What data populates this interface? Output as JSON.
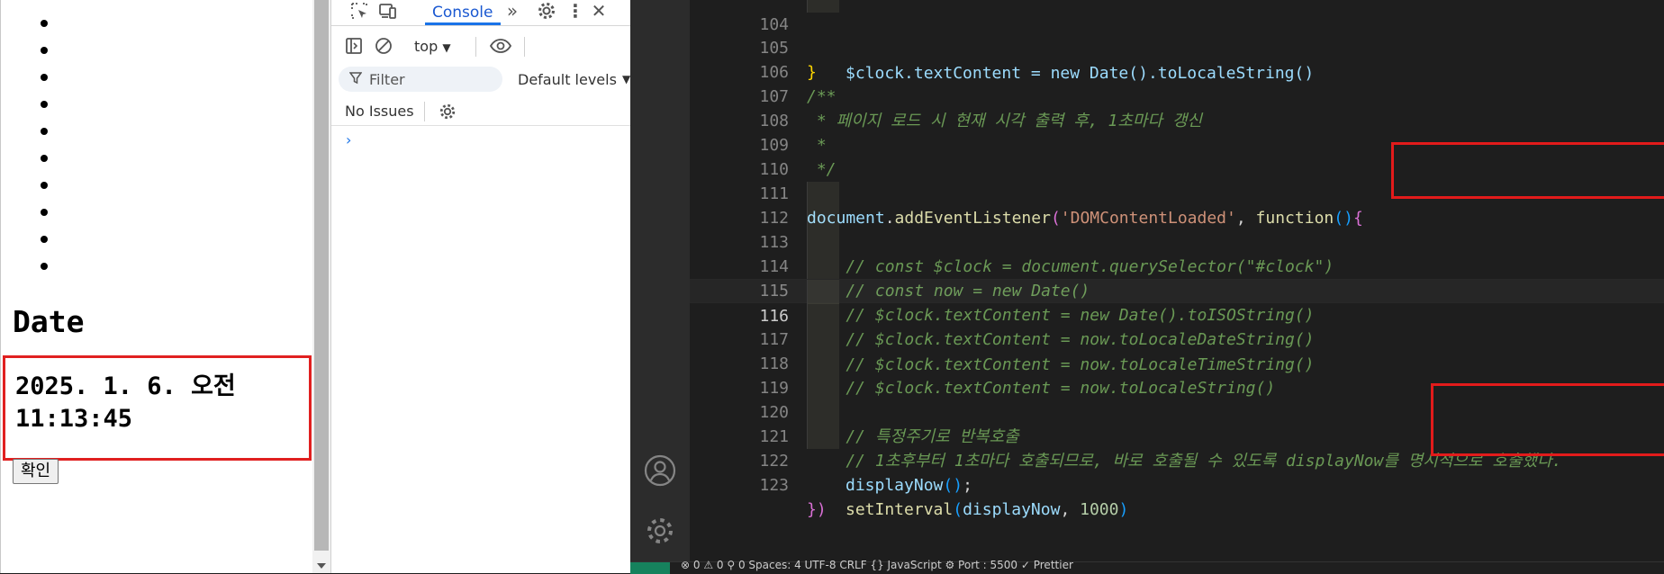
{
  "page": {
    "bullet_count": 10,
    "heading": "Date",
    "clock": "2025. 1. 6. 오전 11:13:45",
    "confirm_button": "확인"
  },
  "devtools": {
    "tab_console": "Console",
    "context": "top",
    "filter_placeholder": "Filter",
    "levels": "Default levels",
    "issues": "No Issues",
    "prompt": "›"
  },
  "editor": {
    "lines": [
      {
        "n": "104",
        "code": "$clock.textContent = new Date().toLocaleString()"
      },
      {
        "n": "105",
        "code": "}"
      },
      {
        "n": "106",
        "code": "/**"
      },
      {
        "n": "107",
        "code": " * 페이지 로드 시 현재 시각 출력 후, 1초마다 갱신"
      },
      {
        "n": "108",
        "code": " *"
      },
      {
        "n": "109",
        "code": " */"
      },
      {
        "n": "110",
        "code": ""
      },
      {
        "n": "111",
        "code": "document.addEventListener('DOMContentLoaded', function(){"
      },
      {
        "n": "112",
        "code": "    // const $clock = document.querySelector(\"#clock\")"
      },
      {
        "n": "113",
        "code": "    // const now = new Date()"
      },
      {
        "n": "114",
        "code": "    // $clock.textContent = new Date().toISOString()"
      },
      {
        "n": "115",
        "code": "    // $clock.textContent = now.toLocaleDateString()"
      },
      {
        "n": "116",
        "code": "    // $clock.textContent = now.toLocaleTimeString()"
      },
      {
        "n": "117",
        "code": "    // $clock.textContent = now.toLocaleString()"
      },
      {
        "n": "118",
        "code": ""
      },
      {
        "n": "119",
        "code": "    // 특정주기로 반복호출"
      },
      {
        "n": "120",
        "code": "    // 1초후부터 1초마다 호출되므로, 바로 호출될 수 있도록 displayNow를 명시적으로 호출했다."
      },
      {
        "n": "121",
        "code": "    displayNow();"
      },
      {
        "n": "122",
        "code": "    setInterval(displayNow, 1000)"
      },
      {
        "n": "123",
        "code": "})"
      }
    ],
    "active_line": "116",
    "status_text": "⊗ 0 ⚠ 0   ⚲ 0   Spaces: 4   UTF-8   CRLF   {} JavaScript   ⚙   Port : 5500   ✓ Prettier"
  },
  "colors": {
    "highlight_box": "#e21b1b",
    "console_tab": "#1a58d1",
    "comment": "#6a9955",
    "function": "#dcdcaa",
    "string": "#ce9178",
    "number": "#b5cea8"
  },
  "icons": [
    "inspect-icon",
    "device-toolbar-icon",
    "more-tabs-icon",
    "settings-icon",
    "kebab-menu-icon",
    "close-icon",
    "sidebar-toggle-icon",
    "clear-console-icon",
    "dropdown-icon",
    "eye-icon",
    "filter-icon",
    "account-icon",
    "manage-gear-icon"
  ]
}
